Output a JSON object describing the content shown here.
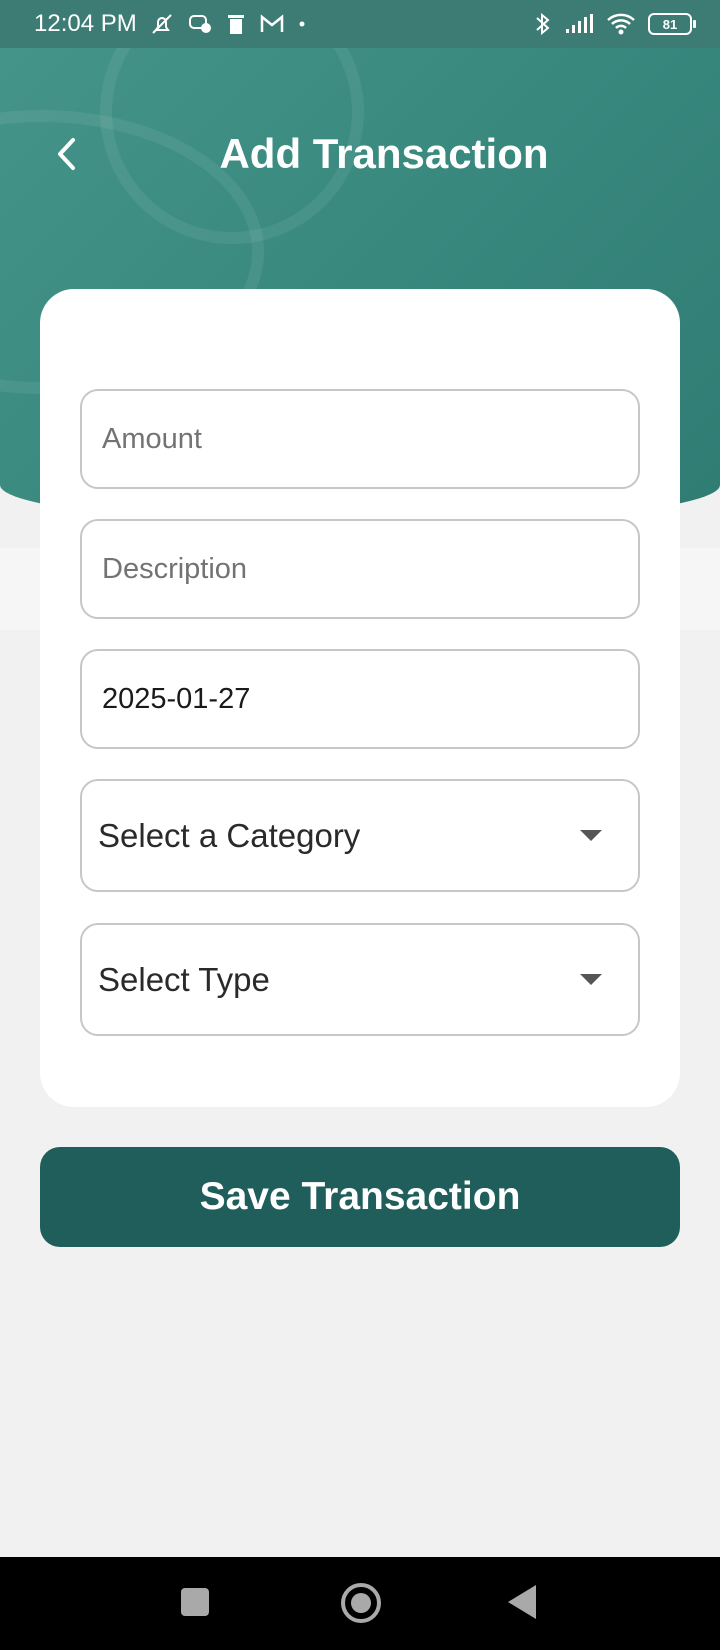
{
  "status_bar": {
    "time": "12:04 PM",
    "left_icons": [
      "alarm-off-icon",
      "messenger-icon",
      "trash-icon",
      "gmail-icon",
      "dot-icon"
    ],
    "right_icons": [
      "bluetooth-icon",
      "signal-icon",
      "wifi-icon"
    ],
    "battery": "81"
  },
  "header": {
    "title": "Add Transaction",
    "back_icon": "chevron-left-icon",
    "color": "#3a8a80"
  },
  "form": {
    "amount": {
      "placeholder": "Amount",
      "value": ""
    },
    "description": {
      "placeholder": "Description",
      "value": ""
    },
    "date": {
      "value": "2025-01-27"
    },
    "category": {
      "selected": "Select a Category"
    },
    "type": {
      "selected": "Select Type"
    }
  },
  "save_button": {
    "label": "Save Transaction",
    "color": "#1f5e5a"
  },
  "nav_bar": {
    "items": [
      "recents-icon",
      "home-icon",
      "back-icon"
    ]
  }
}
